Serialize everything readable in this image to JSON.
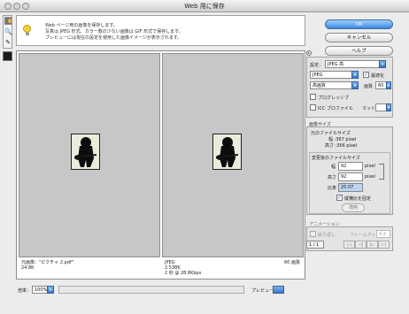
{
  "window": {
    "title": "Web 用に保存"
  },
  "tools": [
    {
      "name": "hand-tool",
      "glyph": "✋"
    },
    {
      "name": "zoom-tool",
      "glyph": "🔍"
    },
    {
      "name": "eyedropper-tool",
      "glyph": "✎"
    }
  ],
  "info": {
    "lines": [
      "Web ページ用の画像を保存します。",
      "写真は JPEG 形式、カラー数の少ない画像は GIF 形式で保存します。",
      "プレビューには現在の設定を使用した画像イメージが表示されます。"
    ]
  },
  "buttons": {
    "ok": "OK",
    "cancel": "キャンセル",
    "help": "ヘルプ"
  },
  "preview": {
    "original": {
      "line1": "元画像：\"ピクチャ 2.pdf\"",
      "line2": "24.8K"
    },
    "optimized": {
      "line1": "JPEG",
      "line2": "2.538K",
      "line3": "2 秒 @ 28.8Kbps",
      "quality": "60 画質"
    }
  },
  "bottom": {
    "zoom_label": "倍率：",
    "zoom_value": "100%",
    "preview_label": "プレビュー："
  },
  "settings": {
    "label": "設定：",
    "preset": "JPEG 高",
    "format": "JPEG",
    "optimize_label": "最適化",
    "quality_level": "高画質",
    "quality_label": "画質",
    "quality_value": "60",
    "progressive_label": "プログレッシブ",
    "icc_label": "ICC プロファイル",
    "matte_label": "マット："
  },
  "image_size": {
    "title": "画像サイズ",
    "original_title": "元のファイルサイズ",
    "orig_width": "幅 :367 pixel",
    "orig_height": "高さ :366 pixel",
    "new_title": "変更後のファイルサイズ",
    "width_label": "幅",
    "width_value": "92",
    "height_label": "高さ",
    "height_value": "92",
    "unit": "pixel",
    "percent_label": "比率",
    "percent_value": "25.07",
    "constrain_label": "縦横比を固定",
    "apply_label": "適用"
  },
  "animation": {
    "title": "アニメーション",
    "loop_label": "繰り返し",
    "delay_label": "フレームディレイ：",
    "delay_value": "0.2",
    "frame_counter": "1 / 1",
    "nav": [
      "|◁",
      "◁|",
      "|▷",
      "▷|"
    ]
  }
}
